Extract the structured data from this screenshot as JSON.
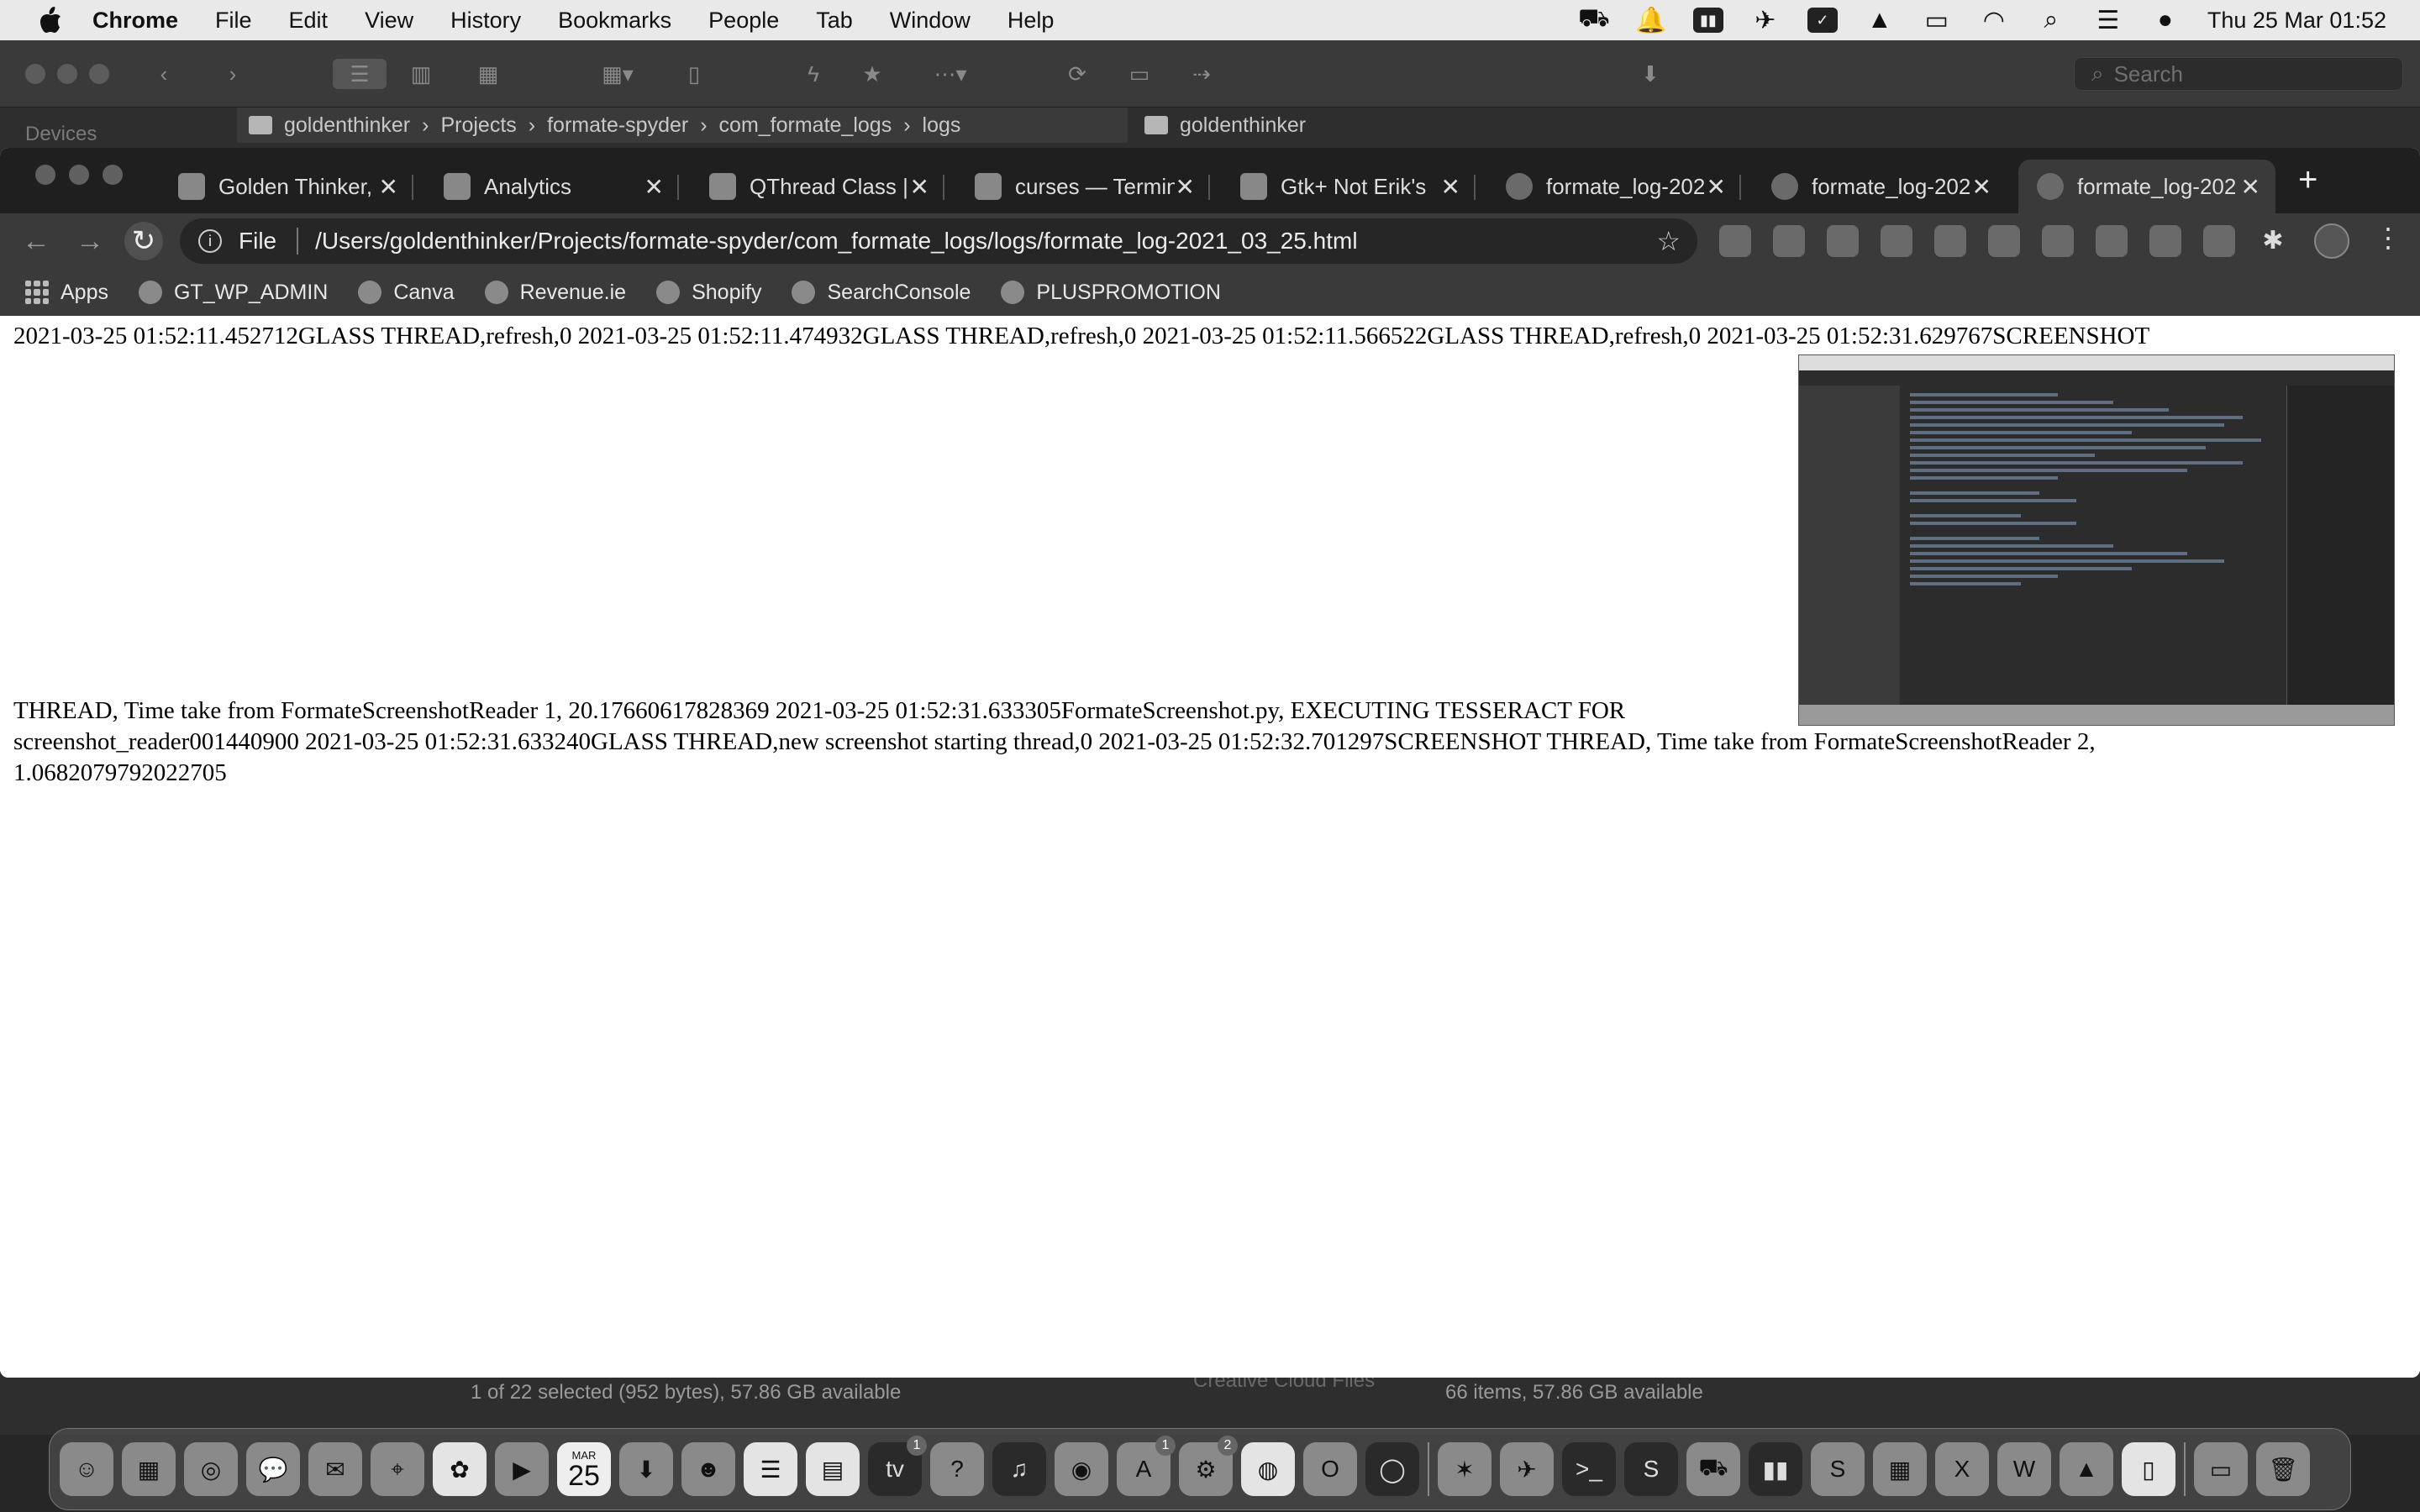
{
  "menubar": {
    "app_name": "Chrome",
    "items": [
      "File",
      "Edit",
      "View",
      "History",
      "Bookmarks",
      "People",
      "Tab",
      "Window",
      "Help"
    ],
    "clock": "Thu 25 Mar  01:52"
  },
  "finder": {
    "search_placeholder": "Search",
    "sidebar_heading": "Devices",
    "path_left": [
      "goldenthinker",
      "Projects",
      "formate-spyder",
      "com_formate_logs",
      "logs"
    ],
    "path_right": "goldenthinker",
    "status_left": "1 of 22 selected (952 bytes), 57.86 GB available",
    "status_right": "66 items, 57.86 GB available",
    "partial_row": "Creative Cloud Files"
  },
  "chrome": {
    "tabs": [
      {
        "title": "Golden Thinker,",
        "icon": "goldenthinker-icon"
      },
      {
        "title": "Analytics",
        "icon": "analytics-icon"
      },
      {
        "title": "QThread Class |",
        "icon": "qt-icon"
      },
      {
        "title": "curses — Termin",
        "icon": "python-icon"
      },
      {
        "title": "Gtk+ Not Erik's",
        "icon": "gtk-icon"
      },
      {
        "title": "formate_log-202",
        "icon": "globe-icon"
      },
      {
        "title": "formate_log-202",
        "icon": "globe-icon"
      },
      {
        "title": "formate_log-202",
        "icon": "globe-icon"
      }
    ],
    "address_scheme": "File",
    "address_url": "/Users/goldenthinker/Projects/formate-spyder/com_formate_logs/logs/formate_log-2021_03_25.html",
    "bookmarks": [
      "Apps",
      "GT_WP_ADMIN",
      "Canva",
      "Revenue.ie",
      "Shopify",
      "SearchConsole",
      "PLUSPROMOTION"
    ]
  },
  "log": {
    "line1": "2021-03-25 01:52:11.452712GLASS THREAD,refresh,0 2021-03-25 01:52:11.474932GLASS THREAD,refresh,0 2021-03-25 01:52:11.566522GLASS THREAD,refresh,0 2021-03-25 01:52:31.629767SCREENSHOT",
    "line2": "THREAD, Time take from FormateScreenshotReader 1, 20.17660617828369 2021-03-25 01:52:31.633305FormateScreenshot.py, EXECUTING TESSERACT FOR",
    "line3": "screenshot_reader001440900 2021-03-25 01:52:31.633240GLASS THREAD,new screenshot starting thread,0 2021-03-25 01:52:32.701297SCREENSHOT THREAD, Time take from FormateScreenshotReader 2,",
    "line4": "1.0682079792022705"
  },
  "dock": {
    "calendar_month": "MAR",
    "calendar_day": "25",
    "appletv_label": "tv",
    "badge_appletv": "1",
    "badge_appstore": "1",
    "badge_settings": "2"
  }
}
